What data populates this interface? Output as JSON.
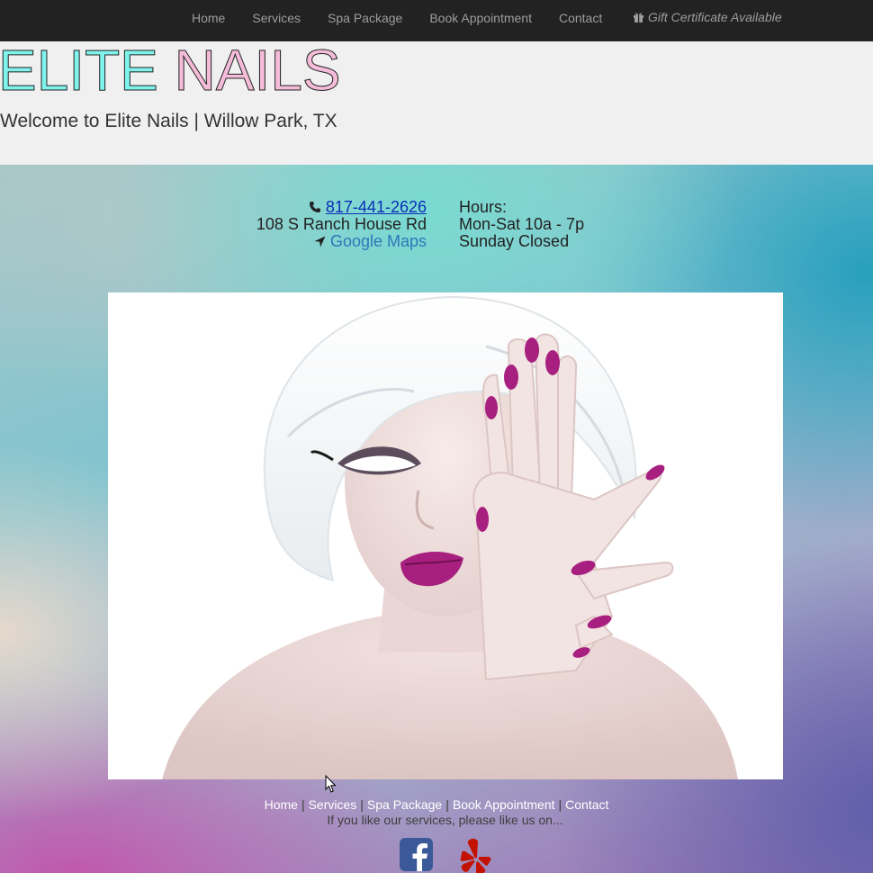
{
  "nav": {
    "items": [
      "Home",
      "Services",
      "Spa Package",
      "Book Appointment",
      "Contact"
    ],
    "gift_label": "Gift Certificate Available"
  },
  "header": {
    "brand_word1": "ELITE",
    "brand_word2": "NAILS",
    "welcome": "Welcome to Elite Nails | Willow Park, TX"
  },
  "contact": {
    "phone": "817-441-2626",
    "address": "108 S Ranch House Rd",
    "maps_label": "Google Maps",
    "hours_title": "Hours:",
    "hours_weekday": "Mon-Sat 10a - 7p",
    "hours_sunday": "Sunday Closed"
  },
  "footer": {
    "links": [
      "Home",
      "Services",
      "Spa Package",
      "Book Appointment",
      "Contact"
    ],
    "like_text": "If you like our services, please like us on..."
  },
  "icons": {
    "phone": "phone-icon",
    "maps": "location-arrow-icon",
    "gift": "gift-icon",
    "facebook": "facebook-icon",
    "yelp": "yelp-icon"
  },
  "colors": {
    "navbar": "#222222",
    "brand_cyan": "#7ff3ec",
    "brand_pink": "#f5bcd9",
    "nail_polish": "#a8207f",
    "facebook": "#3b5998",
    "yelp": "#c41200"
  }
}
